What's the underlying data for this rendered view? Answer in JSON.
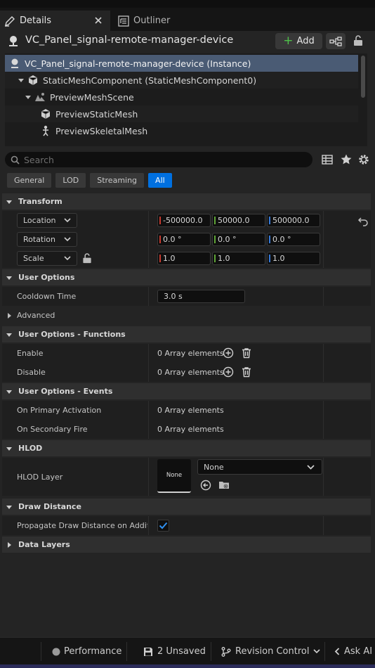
{
  "tabs": [
    {
      "label": "Details",
      "icon": "pencil-icon",
      "active": true
    },
    {
      "label": "Outliner",
      "icon": "list-icon",
      "active": false
    }
  ],
  "actor": {
    "name": "VC_Panel_signal-remote-manager-device",
    "add_label": "Add"
  },
  "tree": [
    {
      "label": "VC_Panel_signal-remote-manager-device (Instance)",
      "icon": "actor-icon",
      "selected": true
    },
    {
      "label": "StaticMeshComponent (StaticMeshComponent0)",
      "icon": "cube-icon"
    },
    {
      "label": "PreviewMeshScene",
      "icon": "scene-icon"
    },
    {
      "label": "PreviewStaticMesh",
      "icon": "cube-icon"
    },
    {
      "label": "PreviewSkeletalMesh",
      "icon": "skeleton-icon"
    }
  ],
  "search": {
    "placeholder": "Search"
  },
  "filters": [
    "General",
    "LOD",
    "Streaming",
    "All"
  ],
  "active_filter": "All",
  "transform": {
    "title": "Transform",
    "location": {
      "label": "Location",
      "x": "-500000.0",
      "y": "50000.0",
      "z": "500000.0"
    },
    "rotation": {
      "label": "Rotation",
      "x": "0.0 °",
      "y": "0.0 °",
      "z": "0.0 °"
    },
    "scale": {
      "label": "Scale",
      "x": "1.0",
      "y": "1.0",
      "z": "1.0"
    }
  },
  "user_options": {
    "title": "User Options",
    "cooldown_label": "Cooldown Time",
    "cooldown_value": "3.0 s",
    "advanced_label": "Advanced"
  },
  "functions": {
    "title": "User Options - Functions",
    "enable_label": "Enable",
    "enable_value": "0 Array elements",
    "disable_label": "Disable",
    "disable_value": "0 Array elements"
  },
  "events": {
    "title": "User Options - Events",
    "primary_label": "On Primary Activation",
    "primary_value": "0 Array elements",
    "secondary_label": "On Secondary Fire",
    "secondary_value": "0 Array elements"
  },
  "hlod": {
    "title": "HLOD",
    "layer_label": "HLOD Layer",
    "thumb_text": "None",
    "combo_value": "None"
  },
  "draw_distance": {
    "title": "Draw Distance",
    "propagate_label": "Propagate Draw Distance on Additi...",
    "propagate_checked": true
  },
  "data_layers": {
    "title": "Data Layers"
  },
  "status": {
    "performance": "Performance",
    "unsaved": "2 Unsaved",
    "revision": "Revision Control",
    "ask_ai": "Ask AI"
  },
  "colors": {
    "accent": "#0070e0",
    "selection": "#4a5b74",
    "add_plus": "#4fc24a",
    "axis_x": "#c83a2e",
    "axis_y": "#5fa436",
    "axis_z": "#3478d6"
  }
}
